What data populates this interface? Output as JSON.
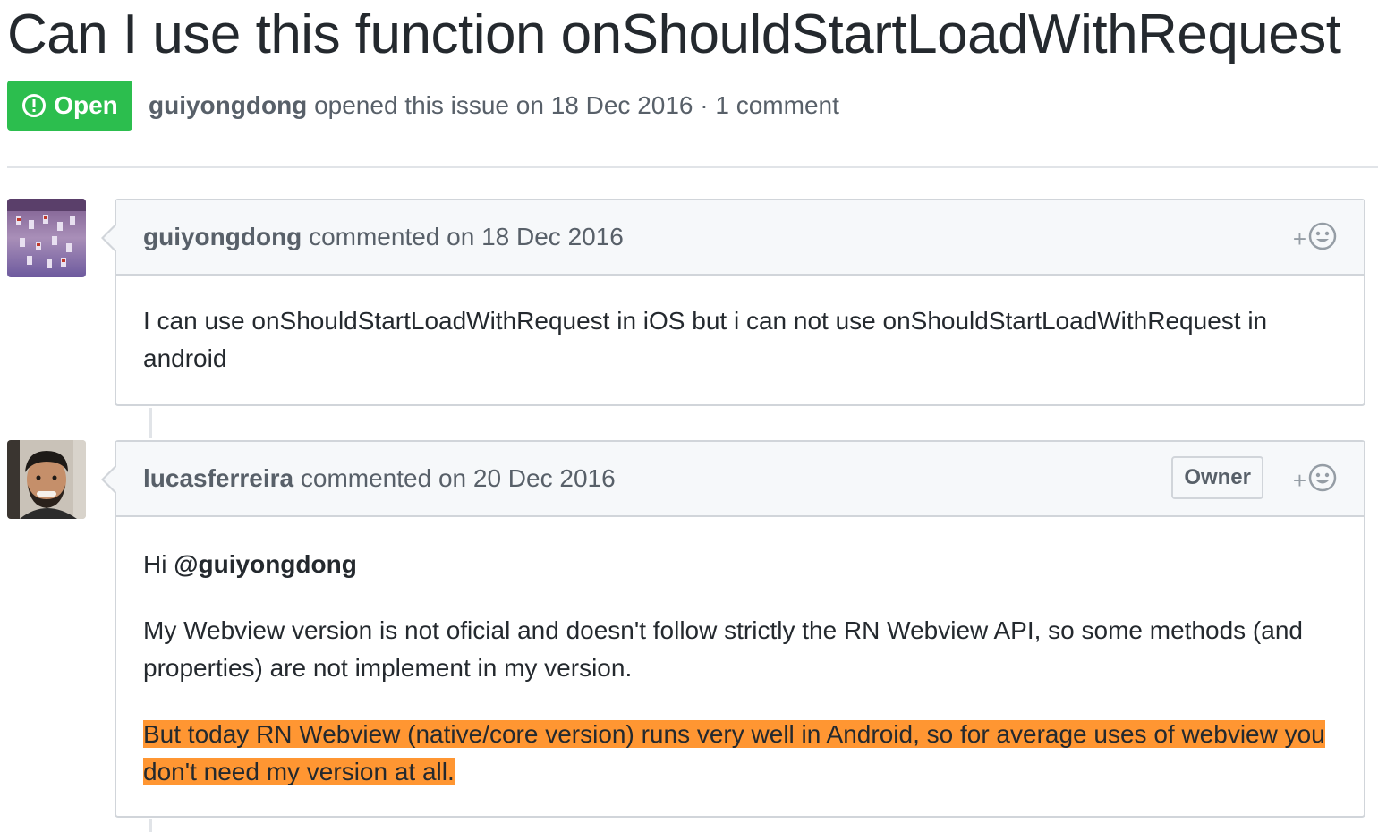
{
  "issue": {
    "title": "Can I use this function onShouldStartLoadWithRequest",
    "state": "Open",
    "author": "guiyongdong",
    "meta_text": " opened this issue on 18 Dec 2016 · 1 comment"
  },
  "comments": [
    {
      "author": "guiyongdong",
      "action_text": " commented on 18 Dec 2016",
      "reaction_plus": "+",
      "body": "I can use onShouldStartLoadWithRequest in iOS but i can not use onShouldStartLoadWithRequest in android"
    },
    {
      "author": "lucasferreira",
      "action_text": " commented on 20 Dec 2016",
      "label": "Owner",
      "reaction_plus": "+",
      "greeting": "Hi ",
      "mention": "@guiyongdong",
      "paragraph2": "My Webview version is not oficial and doesn't follow strictly the RN Webview API, so some methods (and properties) are not implement in my version.",
      "paragraph3": "But today RN Webview (native/core version) runs very well in Android, so for average uses of webview you don't need my version at all."
    }
  ],
  "colors": {
    "open_badge": "#2cbe4e",
    "highlight": "#ff9632",
    "border": "#d1d5da",
    "header_bg": "#f6f8fa",
    "muted_text": "#586069"
  },
  "icons": {
    "state_icon": "issue-opened-icon",
    "reaction_icon": "smiley-icon"
  }
}
